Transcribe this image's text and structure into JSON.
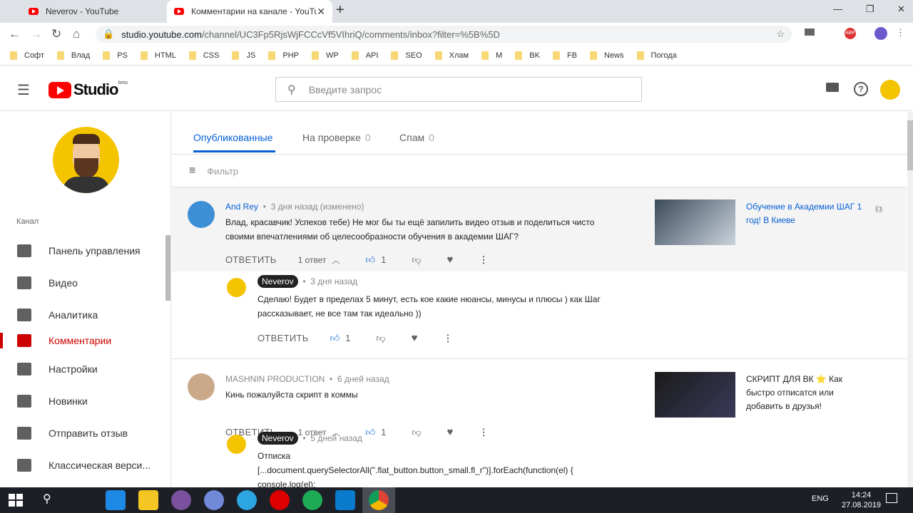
{
  "browser": {
    "tabs": [
      {
        "title": "Neverov - YouTube"
      },
      {
        "title": "Комментарии на канале - YouTube"
      }
    ],
    "url_host": "studio.youtube.com",
    "url_path": "/channel/UC3Fp5RjsWjFCCcVf5VIhriQ/comments/inbox?filter=%5B%5D",
    "bookmarks": [
      "Софт",
      "Влад",
      "PS",
      "HTML",
      "CSS",
      "JS",
      "PHP",
      "WP",
      "API",
      "SEO",
      "Хлам",
      "M",
      "BK",
      "FB",
      "News",
      "Погода"
    ]
  },
  "header": {
    "logo": "Studio",
    "beta": "beta",
    "search_placeholder": "Введите запрос"
  },
  "sidebar": {
    "section": "Канал",
    "items": [
      {
        "label": "Панель управления",
        "icon": "dashboard-icon"
      },
      {
        "label": "Видео",
        "icon": "video-icon"
      },
      {
        "label": "Аналитика",
        "icon": "analytics-icon"
      },
      {
        "label": "Комментарии",
        "icon": "comments-icon",
        "active": true
      }
    ],
    "bottom": [
      {
        "label": "Настройки",
        "icon": "gear-icon"
      },
      {
        "label": "Новинки",
        "icon": "alert-icon"
      },
      {
        "label": "Отправить отзыв",
        "icon": "feedback-icon"
      },
      {
        "label": "Классическая верси...",
        "icon": "classic-icon"
      }
    ]
  },
  "tabs": [
    {
      "label": "Опубликованные",
      "active": true
    },
    {
      "label": "На проверке",
      "count": "0"
    },
    {
      "label": "Спам",
      "count": "0"
    }
  ],
  "filter": "Фильтр",
  "actions": {
    "reply": "ОТВЕТИТЬ"
  },
  "comments": [
    {
      "author": "And Rey",
      "time": "3 дня назад (изменено)",
      "text": "Влад, красавчик! Успехов тебе) Не мог бы ты ещё запилить видео отзыв и поделиться чисто своими впечатлениями об целесообразности обучения в академии ШАГ?",
      "replies": "1 ответ",
      "likes": "1",
      "video": "Обучение в Академии ШАГ 1 год! В Киеве",
      "reply": {
        "author": "Neverov",
        "time": "3 дня назад",
        "text": "Сделаю! Будет в пределах 5 минут, есть кое какие нюансы, минусы и плюсы ) как Шаг рассказывает, не все там так идеально ))",
        "likes": "1"
      }
    },
    {
      "author": "MASHNIN PRODUCTION",
      "time": "6 дней назад",
      "text": "Кинь пожалуйста скрипт в коммы",
      "replies": "1 ответ",
      "likes": "1",
      "video": "СКРИПТ ДЛЯ ВК ⭐ Как быстро отписатся или добавить в друзья!",
      "reply": {
        "author": "Neverov",
        "time": "5 дней назад",
        "text": "Отписка",
        "code": "[...document.querySelectorAll(\".flat_button.button_small.fl_r\")].forEach(function(el) {",
        "code2": "  console.log(el);"
      }
    }
  ],
  "taskbar": {
    "lang": "ENG",
    "time": "14:24",
    "date": "27.08.2019"
  },
  "colors": {
    "accent": "#065fd4",
    "red": "#ff0000"
  }
}
